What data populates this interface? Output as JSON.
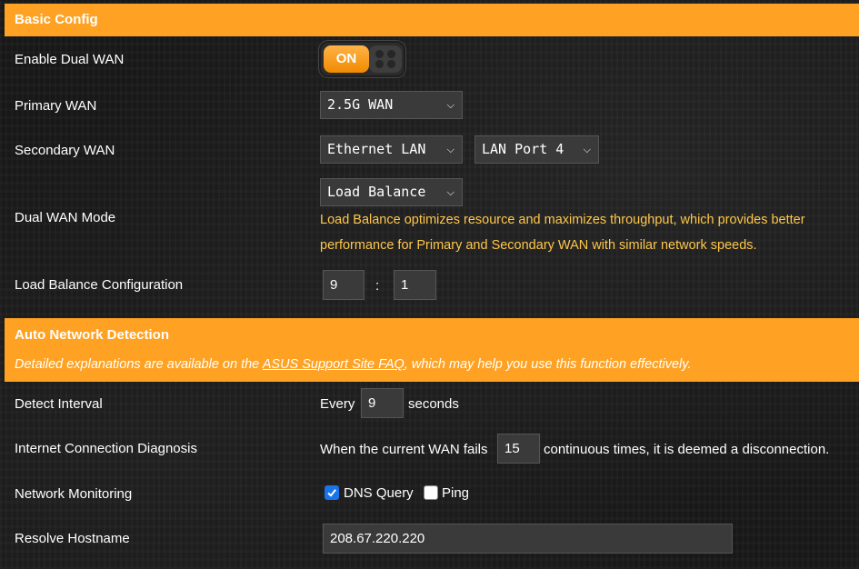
{
  "basic_config": {
    "title": "Basic Config",
    "enable_dual_wan": {
      "label": "Enable Dual WAN",
      "toggle_text": "ON"
    },
    "primary_wan": {
      "label": "Primary WAN",
      "value": "2.5G WAN"
    },
    "secondary_wan": {
      "label": "Secondary WAN",
      "value": "Ethernet LAN",
      "port_value": "LAN Port 4"
    },
    "dual_wan_mode": {
      "label": "Dual WAN Mode",
      "value": "Load Balance",
      "description": "Load Balance optimizes resource and maximizes throughput, which provides better performance for Primary and Secondary WAN with similar network speeds."
    },
    "load_balance": {
      "label": "Load Balance Configuration",
      "primary_ratio": "9",
      "separator": ":",
      "secondary_ratio": "1"
    }
  },
  "auto_detection": {
    "title": "Auto Network Detection",
    "desc_before": "Detailed explanations are available on the ",
    "desc_link": "ASUS Support Site FAQ",
    "desc_after": ", which may help you use this function effectively.",
    "detect_interval": {
      "label": "Detect Interval",
      "prefix": "Every",
      "value": "9",
      "suffix": "seconds"
    },
    "diagnosis": {
      "label": "Internet Connection Diagnosis",
      "prefix": "When the current WAN fails",
      "value": "15",
      "suffix": "continuous times, it is deemed a disconnection."
    },
    "monitoring": {
      "label": "Network Monitoring",
      "dns_label": "DNS Query",
      "dns_checked": true,
      "ping_label": "Ping",
      "ping_checked": false
    },
    "resolve": {
      "label": "Resolve Hostname",
      "value": "208.67.220.220"
    }
  },
  "colors": {
    "accent": "#ffa223",
    "info_text": "#ffc74a",
    "checkbox": "#1a73e8"
  }
}
